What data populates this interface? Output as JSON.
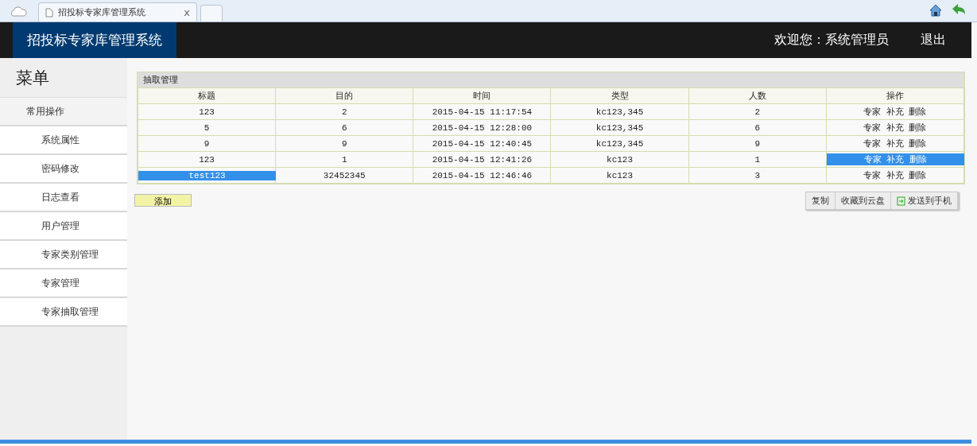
{
  "browser": {
    "tab_title": "招投标专家库管理系统",
    "close_glyph": "x"
  },
  "header": {
    "title": "招投标专家库管理系统",
    "welcome": "欢迎您：系统管理员",
    "logout": "退出"
  },
  "sidebar": {
    "title": "菜单",
    "items": [
      {
        "label": "常用操作",
        "kind": "group"
      },
      {
        "label": "系统属性",
        "kind": "link"
      },
      {
        "label": "密码修改",
        "kind": "link"
      },
      {
        "label": "日志查看",
        "kind": "link"
      },
      {
        "label": "用户管理",
        "kind": "link"
      },
      {
        "label": "专家类别管理",
        "kind": "link"
      },
      {
        "label": "专家管理",
        "kind": "link"
      },
      {
        "label": "专家抽取管理",
        "kind": "link"
      }
    ]
  },
  "panel": {
    "title": "抽取管理",
    "columns": [
      "标题",
      "目的",
      "时间",
      "类型",
      "人数",
      "操作"
    ],
    "rows": [
      {
        "cells": [
          {
            "text": "123",
            "selected": false
          },
          {
            "text": "2",
            "selected": false
          },
          {
            "text": "2015-04-15 11:17:54",
            "selected": false
          },
          {
            "text": "kc123,345",
            "selected": false
          },
          {
            "text": "2",
            "selected": false
          },
          {
            "text": "专家 补充 删除",
            "selected": false
          }
        ]
      },
      {
        "cells": [
          {
            "text": "5",
            "selected": false
          },
          {
            "text": "6",
            "selected": false
          },
          {
            "text": "2015-04-15 12:28:00",
            "selected": false
          },
          {
            "text": "kc123,345",
            "selected": false
          },
          {
            "text": "6",
            "selected": false
          },
          {
            "text": "专家 补充 删除",
            "selected": false
          }
        ]
      },
      {
        "cells": [
          {
            "text": "9",
            "selected": false
          },
          {
            "text": "9",
            "selected": false
          },
          {
            "text": "2015-04-15 12:40:45",
            "selected": false
          },
          {
            "text": "kc123,345",
            "selected": false
          },
          {
            "text": "9",
            "selected": false
          },
          {
            "text": "专家 补充 删除",
            "selected": false
          }
        ]
      },
      {
        "cells": [
          {
            "text": "123",
            "selected": false
          },
          {
            "text": "1",
            "selected": false
          },
          {
            "text": "2015-04-15 12:41:26",
            "selected": false
          },
          {
            "text": "kc123",
            "selected": false
          },
          {
            "text": "1",
            "selected": false
          },
          {
            "text": "专家 补充 删除",
            "selected": true
          }
        ]
      },
      {
        "cells": [
          {
            "text": "test123",
            "selected": true
          },
          {
            "text": "32452345",
            "selected": false
          },
          {
            "text": "2015-04-15 12:46:46",
            "selected": false
          },
          {
            "text": "kc123",
            "selected": false
          },
          {
            "text": "3",
            "selected": false
          },
          {
            "text": "专家 补充 删除",
            "selected": false
          }
        ]
      }
    ],
    "add_button": "添加"
  },
  "context_menu": {
    "items": [
      "复制",
      "收藏到云盘",
      "发送到手机"
    ]
  }
}
